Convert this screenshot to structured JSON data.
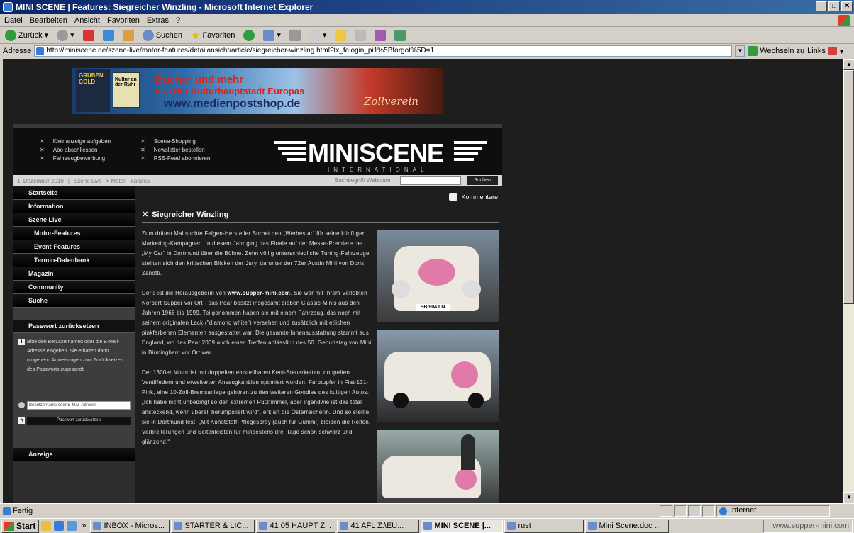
{
  "window": {
    "title": "MINI SCENE | Features: Siegreicher Winzling - Microsoft Internet Explorer"
  },
  "menu": [
    "Datei",
    "Bearbeiten",
    "Ansicht",
    "Favoriten",
    "Extras",
    "?"
  ],
  "toolbar": {
    "back": "Zurück",
    "search": "Suchen",
    "favorites": "Favoriten"
  },
  "address": {
    "label": "Adresse",
    "url": "http://miniscene.de/szene-live/motor-features/detailansicht/article/siegreicher-winzling.html?tx_felogin_pi1%5Bforgot%5D=1",
    "go": "Wechseln zu",
    "links": "Links"
  },
  "banner": {
    "box_text": "GRUBEN GOLD",
    "book_text": "Kultur an der Ruhr",
    "line1": "Bücher und mehr",
    "line2": "aus der Kulturhauptstadt Europas",
    "line3": "www.medienpostshop.de",
    "zoll": "Zollverein"
  },
  "site": {
    "header_links": [
      "Kleinanzeige aufgeben",
      "Abo abschliessen",
      "Fahrzeugbewerbung",
      "Scene-Shopping",
      "Newsletter bestellen",
      "RSS-Feed abonnieren"
    ],
    "logo": "MINISCENE",
    "logo_sub": "INTERNATIONAL",
    "breadcrumb": {
      "date": "1. Dezember 2010",
      "link": "Szene Live",
      "rest": "> Motor-Features"
    },
    "search_label": "Suchbegriff/ Webcode",
    "search_button": "Suchen"
  },
  "nav": {
    "items": [
      "Startseite",
      "Information",
      "Szene Live",
      "Motor-Features",
      "Event-Features",
      "Termin-Datenbank",
      "Magazin",
      "Community",
      "Suche"
    ],
    "password_head": "Passwort zurücksetzen",
    "password_text": "Bitte den Benutzernamen oder die E-Mail-Adresse eingeben. Sie erhalten dann umgehend Anweisungen zum Zurücksetzen des Passworts zugesandt.",
    "password_placeholder": "Benutzername oder E-Mail-Adresse",
    "password_submit": "Passwort zurücksetzen",
    "anzeige": "Anzeige"
  },
  "article": {
    "comments": "Kommentare",
    "title": "Siegreicher Winzling",
    "p1": "Zum dritten Mal suchte Felgen-Hersteller Borbet den „Werbestar“ für seine künftigen Marketing-Kampagnen. In diesem Jahr ging das Finale auf der Messe-Premiere der „My Car“ in Dortmund über die Bühne. Zehn völlig unterschiedliche Tuning-Fahrzeuge stellten sich den kritischen Blicken der Jury, darunter der 72er Austin Mini von Doris Zanotti.",
    "p2a": "Doris ist die Herausgeberin von ",
    "p2link": "www.supper-mini.com",
    "p2b": ". Sie war mit Ihrem Verlobten Norbert Supper vor Ort - das Paar besitzt insgesamt sieben Classic-Minis aus den Jahren 1966 bis 1999. Teilgenommen haben sie mit einem Fahrzeug, das noch mit seinem originalen Lack (\"diamond white\") versehen und zusätzlich mit etlichen pinkfarbenen Elementen ausgestattet war. Die gesamte Innenausstattung stammt aus England, wo das Paar 2009 auch einen Treffen anlässlich des 50. Geburtstag von Mini in Birmingham vor Ort war.",
    "p3": "Der 1300er Motor ist mit doppelten einstellbaren Kent-Steuerketten, doppelten Ventilfedern und erweiterten Ansaugkanälen optimiert worden. Farbtupfer in Fiat-131-Pink, eine 10-Zoll-Bremsanlage gehören zu den weiteren Goodies des kultigen Autos. „Ich habe nicht unbedingt so den extremen Putzfimmel, aber irgendwie ist das total ansteckend, wenn überall herumpoliert wird“, erklärt die Österreicherin. Und so stellte sie in Dortmund fest: „Mit Kunststoff-Pflegespray (auch für Gummi) bleiben die Reifen, Verbreiterungen und Seitenleisten für mindestens drei Tage schön schwarz und glänzend.“",
    "plate": "SB 904 LN"
  },
  "status": {
    "text": "Fertig",
    "zone": "Internet"
  },
  "taskbar": {
    "start": "Start",
    "tasks": [
      "INBOX - Micros...",
      "STARTER & LIC...",
      "41 05 HAUPT Z...",
      "41 AFL Z:\\EU...",
      "MINI SCENE |...",
      "rust",
      "Mini Scene.doc ..."
    ],
    "tray": "www.supper-mini.com"
  }
}
